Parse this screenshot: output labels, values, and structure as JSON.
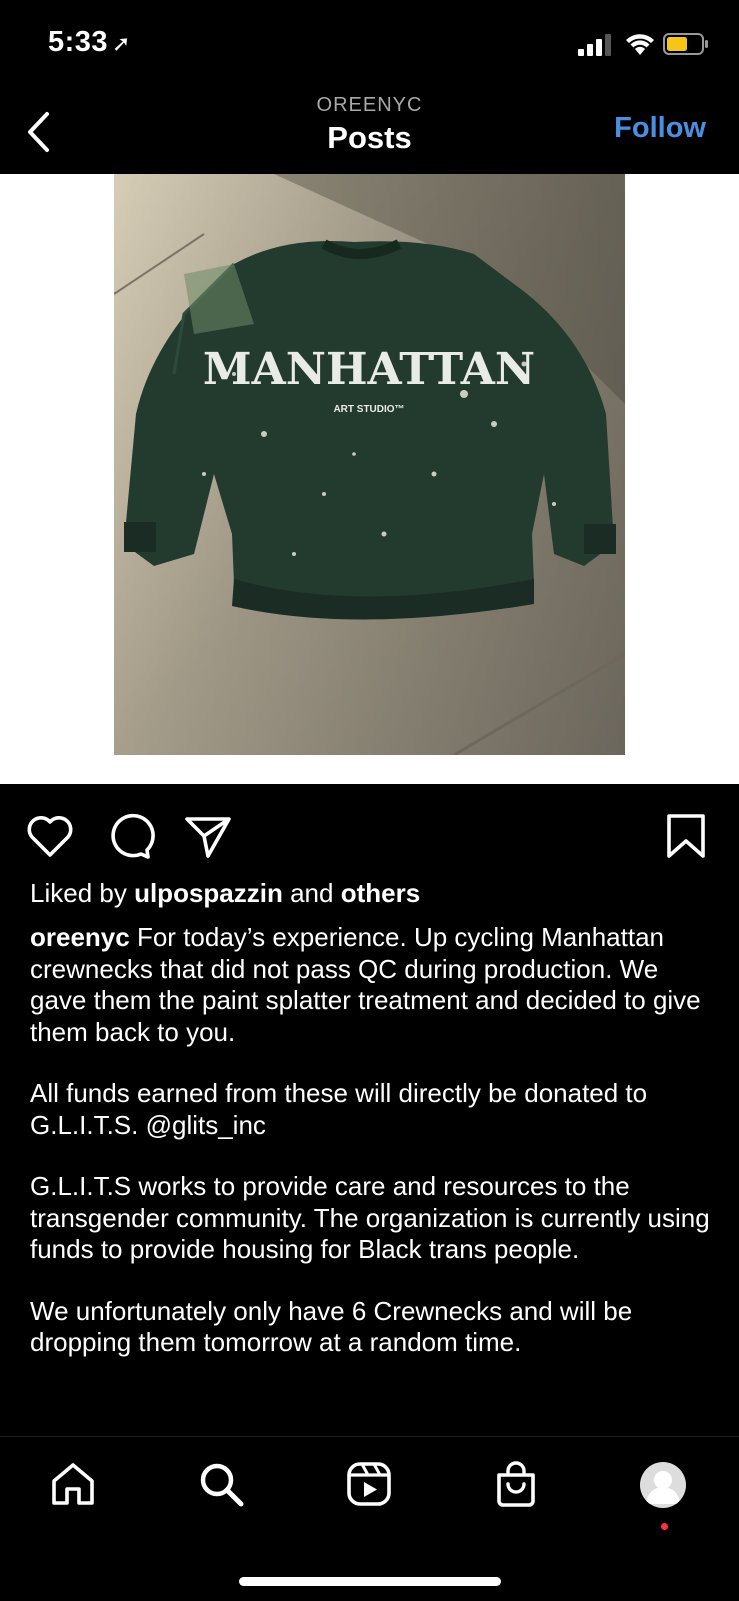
{
  "status": {
    "time": "5:33",
    "location_icon": "location-arrow-icon",
    "battery_color": "#f5c518"
  },
  "header": {
    "username": "OREENYC",
    "title": "Posts",
    "follow_label": "Follow",
    "follow_color": "#4a90e2"
  },
  "post": {
    "image": {
      "text_big": "MANHATTAN",
      "text_small": "ART STUDIO™"
    },
    "likes": {
      "prefix": "Liked by",
      "user": "ulpospazzin",
      "middle": "and",
      "others": "others"
    },
    "caption": {
      "username": "oreenyc",
      "p1": "For today’s experience. Up cycling Manhattan crewnecks that did not pass QC during production. We gave them the paint splatter treatment and decided to give them back to you.",
      "p2": "All funds earned from these will directly be donated to G.L.I.T.S. @glits_inc",
      "p3": "G.L.I.T.S works to provide care and resources to the transgender community. The organization is currently using funds to provide housing for Black trans people.",
      "p4": "We unfortunately only have 6 Crewnecks and will be dropping them tomorrow at a random time."
    }
  },
  "nav": {
    "items": [
      "home-icon",
      "search-icon",
      "reels-icon",
      "shop-icon",
      "profile-avatar"
    ],
    "notification_dot_color": "#ff3040"
  }
}
